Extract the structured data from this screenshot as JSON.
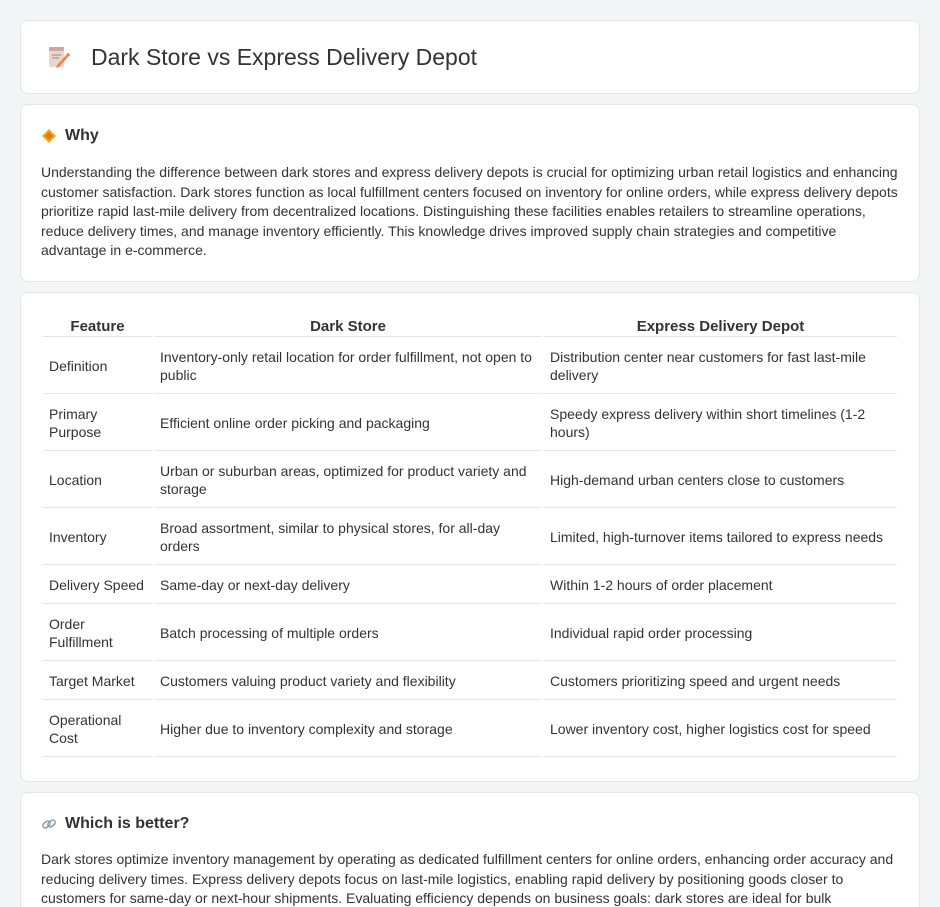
{
  "header": {
    "title": "Dark Store vs Express Delivery Depot",
    "icon": "pencil-notepad-icon"
  },
  "why": {
    "heading": "Why",
    "icon": "diamond-sign-icon",
    "body": "Understanding the difference between dark stores and express delivery depots is crucial for optimizing urban retail logistics and enhancing customer satisfaction. Dark stores function as local fulfillment centers focused on inventory for online orders, while express delivery depots prioritize rapid last-mile delivery from decentralized locations. Distinguishing these facilities enables retailers to streamline operations, reduce delivery times, and manage inventory efficiently. This knowledge drives improved supply chain strategies and competitive advantage in e-commerce."
  },
  "table": {
    "headers": [
      "Feature",
      "Dark Store",
      "Express Delivery Depot"
    ],
    "rows": [
      [
        "Definition",
        "Inventory-only retail location for order fulfillment, not open to public",
        "Distribution center near customers for fast last-mile delivery"
      ],
      [
        "Primary Purpose",
        "Efficient online order picking and packaging",
        "Speedy express delivery within short timelines (1-2 hours)"
      ],
      [
        "Location",
        "Urban or suburban areas, optimized for product variety and storage",
        "High-demand urban centers close to customers"
      ],
      [
        "Inventory",
        "Broad assortment, similar to physical stores, for all-day orders",
        "Limited, high-turnover items tailored to express needs"
      ],
      [
        "Delivery Speed",
        "Same-day or next-day delivery",
        "Within 1-2 hours of order placement"
      ],
      [
        "Order Fulfillment",
        "Batch processing of multiple orders",
        "Individual rapid order processing"
      ],
      [
        "Target Market",
        "Customers valuing product variety and flexibility",
        "Customers prioritizing speed and urgent needs"
      ],
      [
        "Operational Cost",
        "Higher due to inventory complexity and storage",
        "Lower inventory cost, higher logistics cost for speed"
      ]
    ]
  },
  "better": {
    "heading": "Which is better?",
    "icon": "link-icon",
    "body": "Dark stores optimize inventory management by operating as dedicated fulfillment centers for online orders, enhancing order accuracy and reducing delivery times. Express delivery depots focus on last-mile logistics, enabling rapid delivery by positioning goods closer to customers for same-day or next-hour shipments. Evaluating efficiency depends on business goals: dark stores are ideal for bulk processing, while express delivery depots excel in speed and localized distribution."
  }
}
